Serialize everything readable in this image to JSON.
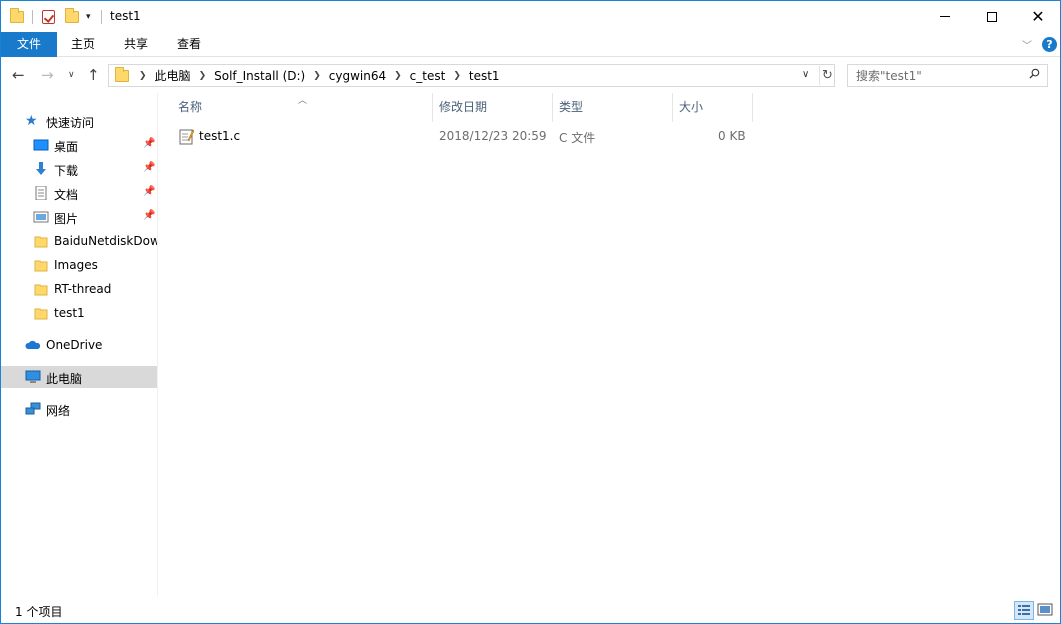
{
  "window": {
    "title": "test1"
  },
  "ribbon": {
    "tabs": [
      "文件",
      "主页",
      "共享",
      "查看"
    ],
    "help": "?"
  },
  "address": {
    "crumbs": [
      "此电脑",
      "Solf_Install (D:)",
      "cygwin64",
      "c_test",
      "test1"
    ]
  },
  "search": {
    "placeholder": "搜索\"test1\""
  },
  "sidebar": {
    "quick_access": "快速访问",
    "pinned": [
      "桌面",
      "下载",
      "文档",
      "图片"
    ],
    "folders": [
      "BaiduNetdiskDow",
      "Images",
      "RT-thread",
      "test1"
    ],
    "onedrive": "OneDrive",
    "this_pc": "此电脑",
    "network": "网络"
  },
  "columns": {
    "name": "名称",
    "modified": "修改日期",
    "type": "类型",
    "size": "大小"
  },
  "files": [
    {
      "name": "test1.c",
      "modified": "2018/12/23 20:59",
      "type": "C 文件",
      "size": "0 KB"
    }
  ],
  "status": {
    "count": "1 个项目"
  },
  "colors": {
    "accent": "#1979ca",
    "selected_bg": "#d9d9d9",
    "header_text": "#4c607a"
  }
}
